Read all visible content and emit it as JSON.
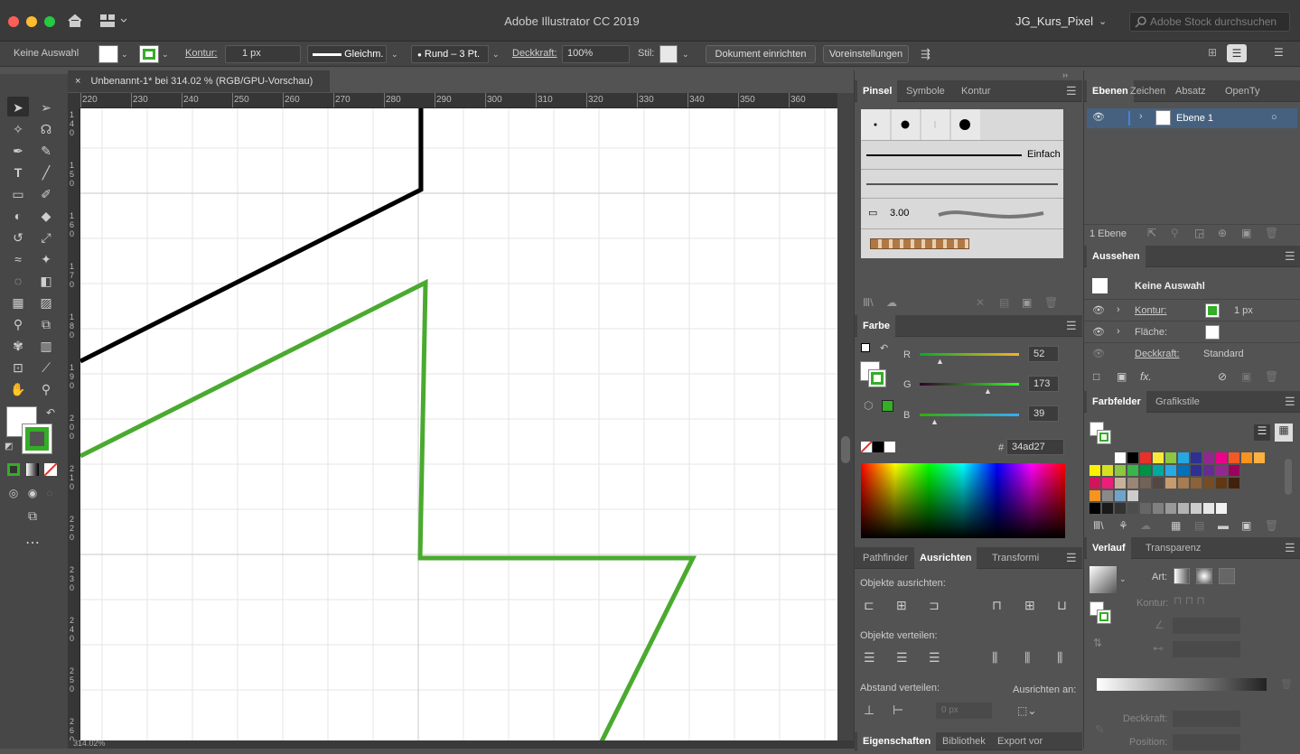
{
  "app": {
    "title": "Adobe Illustrator CC 2019",
    "workspace": "JG_Kurs_Pixel",
    "stock_placeholder": "Adobe Stock durchsuchen"
  },
  "control": {
    "selection": "Keine Auswahl",
    "stroke_label": "Kontur:",
    "stroke_value": "1 px",
    "brush_profile": "Gleichm.",
    "brush": "Rund – 3 Pt.",
    "opacity_label": "Deckkraft:",
    "opacity_value": "100%",
    "style_label": "Stil:",
    "doc_setup": "Dokument einrichten",
    "preferences": "Voreinstellungen"
  },
  "document": {
    "tab_title": "Unbenannt-1* bei 314.02 % (RGB/GPU-Vorschau)",
    "close": "×",
    "ruler_top": [
      "220",
      "230",
      "240",
      "250",
      "260",
      "270",
      "280",
      "290",
      "300",
      "310",
      "320",
      "330",
      "340",
      "350",
      "360"
    ],
    "ruler_left": [
      {
        "n": "140"
      },
      {
        "n": "150"
      },
      {
        "n": "160"
      },
      {
        "n": "170"
      },
      {
        "n": "180"
      },
      {
        "n": "190"
      },
      {
        "n": "200"
      },
      {
        "n": "210"
      },
      {
        "n": "220"
      },
      {
        "n": "230"
      },
      {
        "n": "240"
      },
      {
        "n": "250"
      },
      {
        "n": "260"
      }
    ],
    "status": "314.02%"
  },
  "brushes": {
    "tabs": [
      "Pinsel",
      "Symbole",
      "Kontur"
    ],
    "basic": "Einfach",
    "size": "3.00"
  },
  "color": {
    "tab": "Farbe",
    "r_label": "R",
    "g_label": "G",
    "b_label": "B",
    "r": "52",
    "g": "173",
    "b": "39",
    "hex_label": "#",
    "hex": "34ad27",
    "swatch": "#34ad27"
  },
  "align": {
    "tabs": [
      "Pathfinder",
      "Ausrichten",
      "Transformi"
    ],
    "align_objects": "Objekte ausrichten:",
    "distribute_objects": "Objekte verteilen:",
    "distribute_spacing": "Abstand verteilen:",
    "align_to": "Ausrichten an:",
    "spacing_placeholder": "0 px"
  },
  "bottom_tabs": [
    "Eigenschaften",
    "Bibliothek",
    "Export vor"
  ],
  "layers": {
    "tabs": [
      "Ebenen",
      "Zeichen",
      "Absatz",
      "OpenTy"
    ],
    "layer_name": "Ebene 1",
    "count": "1 Ebene"
  },
  "appearance": {
    "title": "Aussehen",
    "selection": "Keine Auswahl",
    "stroke": "Kontur:",
    "stroke_val": "1 px",
    "fill": "Fläche:",
    "opacity": "Deckkraft:",
    "opacity_val": "Standard",
    "fx": "fx."
  },
  "swatches": {
    "tabs": [
      "Farbfelder",
      "Grafikstile"
    ],
    "row1": [
      "#ffffff",
      "#000000",
      "#e8312a",
      "#f7ea3a",
      "#8dc63f",
      "#27a7e0",
      "#2e3192",
      "#92278f",
      "#ec008c",
      "#f15a24",
      "#f7931e",
      "#fbb040"
    ],
    "row2": [
      "#fff200",
      "#d7df23",
      "#8dc63f",
      "#39b54a",
      "#009245",
      "#00a99d",
      "#29abe2",
      "#0071bc",
      "#2e3192",
      "#662d91",
      "#93278f",
      "#9e005d"
    ],
    "row3": [
      "#d4145a",
      "#ed1e79",
      "#c7b299",
      "#998675",
      "#736357",
      "#534741",
      "#c69c6d",
      "#a67c52",
      "#8c6239",
      "#754c24",
      "#603813",
      "#42210b"
    ],
    "row4": [
      "#f7931e",
      "#8a8a8a",
      "#6fa4c9",
      "#cccccc"
    ],
    "row5": [
      "#000000",
      "#1a1a1a",
      "#333333",
      "#4d4d4d",
      "#666666",
      "#808080",
      "#999999",
      "#b3b3b3",
      "#cccccc",
      "#e6e6e6",
      "#f2f2f2"
    ]
  },
  "gradient": {
    "tabs": [
      "Verlauf",
      "Transparenz"
    ],
    "type_label": "Art:",
    "stroke_label": "Kontur:",
    "opacity_label": "Deckkraft:",
    "position_label": "Position:"
  }
}
